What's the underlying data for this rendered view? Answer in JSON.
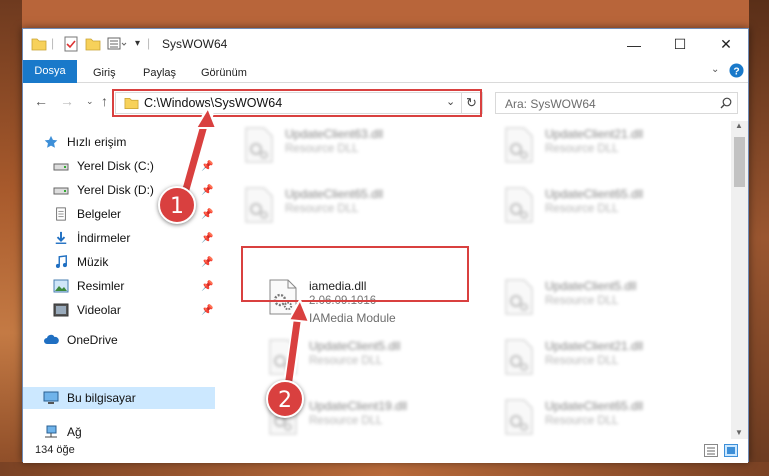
{
  "window": {
    "title": "SysWOW64",
    "controls": {
      "minimize": "—",
      "maximize": "☐",
      "close": "✕"
    }
  },
  "ribbon": {
    "tabs": [
      {
        "label": "Dosya"
      },
      {
        "label": "Giriş"
      },
      {
        "label": "Paylaş"
      },
      {
        "label": "Görünüm"
      }
    ]
  },
  "address": {
    "path": "C:\\Windows\\SysWOW64",
    "search_placeholder": "Ara: SysWOW64"
  },
  "sidebar": {
    "items": [
      {
        "label": "Hızlı erişim",
        "icon": "star-icon"
      },
      {
        "label": "Yerel Disk (C:)",
        "icon": "drive-icon"
      },
      {
        "label": "Yerel Disk (D:)",
        "icon": "drive-icon"
      },
      {
        "label": "Belgeler",
        "icon": "documents-icon"
      },
      {
        "label": "İndirmeler",
        "icon": "download-icon"
      },
      {
        "label": "Müzik",
        "icon": "music-icon"
      },
      {
        "label": "Resimler",
        "icon": "pictures-icon"
      },
      {
        "label": "Videolar",
        "icon": "videos-icon"
      },
      {
        "label": "OneDrive",
        "icon": "cloud-icon"
      },
      {
        "label": "Bu bilgisayar",
        "icon": "computer-icon"
      },
      {
        "label": "Ağ",
        "icon": "network-icon"
      }
    ]
  },
  "files": [
    {
      "name": "UpdateClient63.dll",
      "desc": "Resource DLL"
    },
    {
      "name": "UpdateClient21.dll",
      "desc": "Resource DLL"
    },
    {
      "name": "UpdateClient65.dll",
      "desc": "Resource DLL"
    },
    {
      "name": "UpdateClient65.dll",
      "desc": "Resource DLL"
    },
    {
      "name": "iamedia.dll",
      "version": "2.06.09.1016",
      "desc": "IAMedia Module"
    },
    {
      "name": "UpdateClient5.dll",
      "desc": "Resource DLL"
    },
    {
      "name": "UpdateClient5.dll",
      "desc": "Resource DLL"
    },
    {
      "name": "UpdateClient21.dll",
      "desc": "Resource DLL"
    },
    {
      "name": "UpdateClient19.dll",
      "desc": "Resource DLL"
    },
    {
      "name": "UpdateClient65.dll",
      "desc": "Resource DLL"
    }
  ],
  "status": {
    "count": "134 öğe"
  },
  "markers": {
    "one": "1",
    "two": "2"
  },
  "colors": {
    "accent": "#1979ca",
    "highlight": "#d9403f",
    "selected": "#cce8ff"
  }
}
